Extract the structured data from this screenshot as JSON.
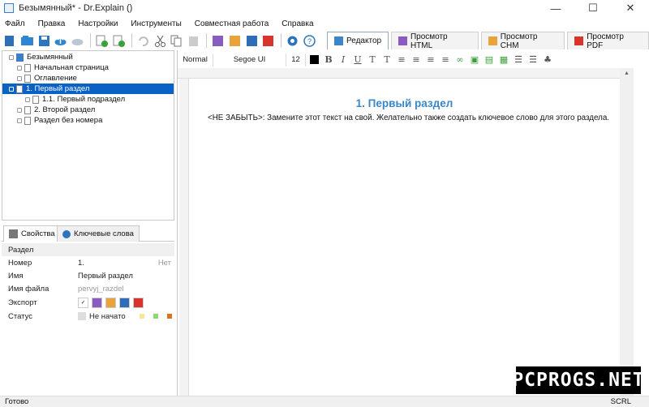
{
  "window": {
    "title": "Безымянный* - Dr.Explain ()",
    "minimize": "—",
    "maximize": "☐",
    "close": "✕"
  },
  "menu": [
    "Файл",
    "Правка",
    "Настройки",
    "Инструменты",
    "Совместная работа",
    "Справка"
  ],
  "tabs": [
    {
      "label": "Редактор",
      "active": true,
      "icon": "editor-icon"
    },
    {
      "label": "Просмотр HTML",
      "active": false,
      "icon": "html-icon"
    },
    {
      "label": "Просмотр CHM",
      "active": false,
      "icon": "chm-icon"
    },
    {
      "label": "Просмотр PDF",
      "active": false,
      "icon": "pdf-icon"
    }
  ],
  "tree": {
    "items": [
      {
        "label": "Безымянный",
        "level": 0,
        "type": "book"
      },
      {
        "label": "Начальная страница",
        "level": 1,
        "type": "page"
      },
      {
        "label": "Оглавление",
        "level": 1,
        "type": "page"
      },
      {
        "label": "1. Первый раздел",
        "level": 1,
        "type": "page",
        "selected": true
      },
      {
        "label": "1.1. Первый подраздел",
        "level": 2,
        "type": "page"
      },
      {
        "label": "2. Второй раздел",
        "level": 1,
        "type": "page"
      },
      {
        "label": "Раздел без номера",
        "level": 1,
        "type": "page"
      }
    ]
  },
  "property_tabs": {
    "properties": "Свойства",
    "keywords": "Ключевые слова"
  },
  "properties": {
    "section_header": "Раздел",
    "number_label": "Номер",
    "number_value": "1.",
    "number_hint": "Нет",
    "name_label": "Имя",
    "name_value": "Первый раздел",
    "filename_label": "Имя файла",
    "filename_value": "pervyj_razdel",
    "export_label": "Экспорт",
    "status_label": "Статус",
    "status_value": "Не начато"
  },
  "editor_toolbar": {
    "style": "Normal",
    "font": "Segoe UI",
    "size": "12"
  },
  "document": {
    "heading": "1. Первый раздел",
    "body": "<НЕ ЗАБЫТЬ>: Замените этот текст на свой. Желательно также создать ключевое слово для этого раздела."
  },
  "status": {
    "left": "Готово",
    "right": "SCRL"
  },
  "watermark": "PCPROGS.NET",
  "colors": {
    "selection": "#0a62c6",
    "heading": "#3a86c8",
    "status_yellow": "#f5e79a",
    "status_green": "#8fd86b",
    "status_orange": "#d8731f"
  }
}
